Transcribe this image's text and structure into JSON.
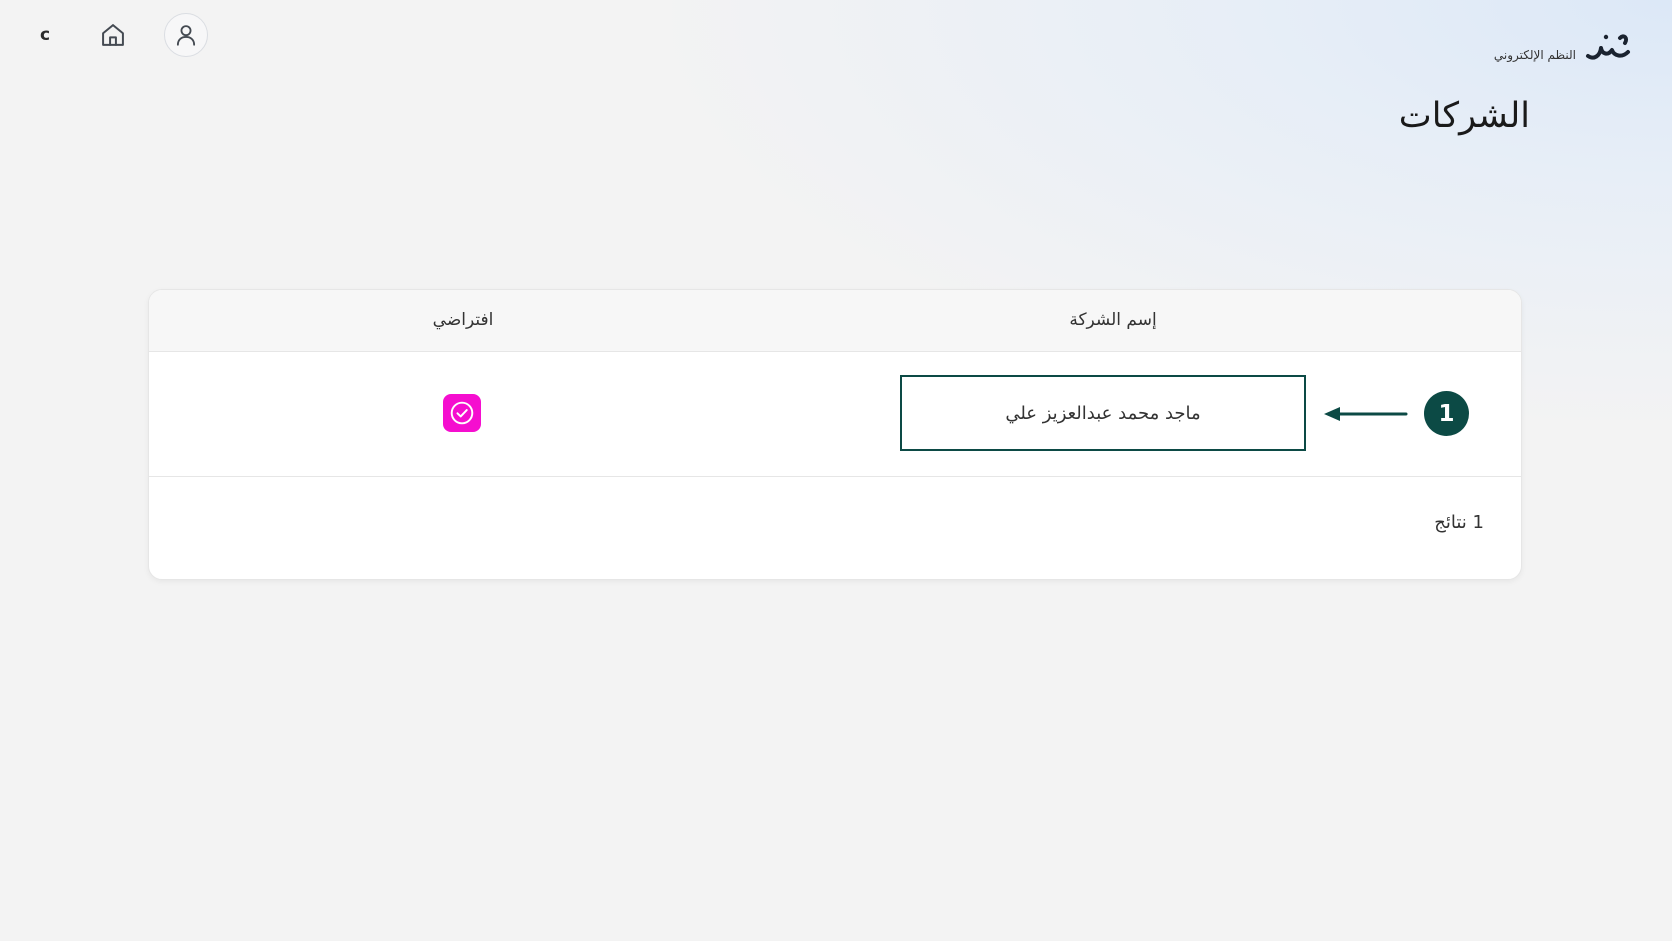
{
  "header": {
    "lang_toggle": "c",
    "home_icon": "home-icon",
    "profile_icon": "user-icon",
    "logo_text": "النظم الإلكتروني",
    "logo_icon": "brand-logo-icon"
  },
  "page": {
    "title": "الشركات"
  },
  "table": {
    "columns": [
      "إسم الشركة",
      "افتراضي"
    ],
    "rows": [
      {
        "company_name": "ماجد محمد عبدالعزيز علي",
        "is_default": true
      }
    ],
    "results_label": "1 نتائج"
  },
  "annotation": {
    "step": "1",
    "arrow_icon": "arrow-left-icon"
  },
  "colors": {
    "accent_dark_teal": "#0c4a45",
    "default_check": "#f50ecf"
  }
}
